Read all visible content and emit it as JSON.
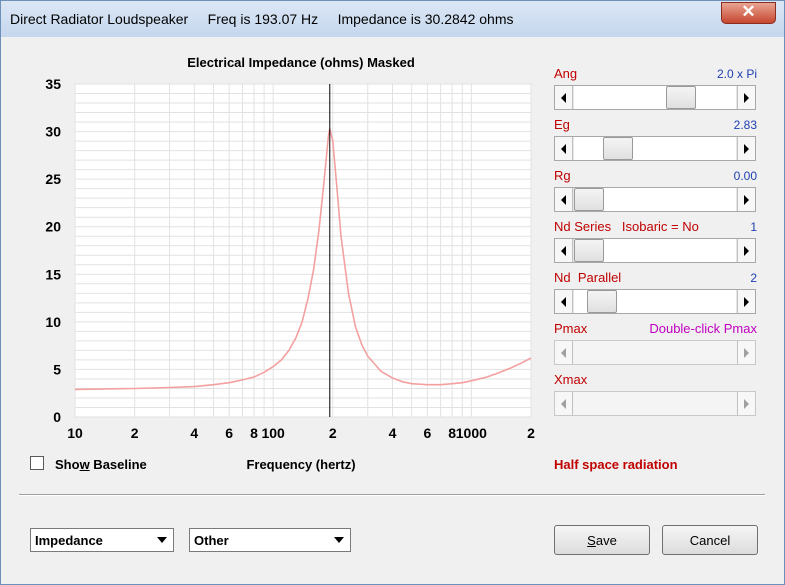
{
  "window": {
    "title": "Direct Radiator Loudspeaker     Freq is 193.07 Hz     Impedance is 30.2842 ohms",
    "close_glyph": "✕"
  },
  "chart_data": {
    "type": "line",
    "title": "Electrical Impedance (ohms)   Masked",
    "xlabel": "Frequency (hertz)",
    "ylabel": "",
    "x_scale": "log",
    "xlim": [
      10,
      2000
    ],
    "ylim": [
      0,
      35
    ],
    "grid": true,
    "x_tick_labels": [
      "10",
      "2",
      "4",
      "6",
      "8",
      "100",
      "2",
      "4",
      "6",
      "8",
      "1000",
      "2"
    ],
    "y_tick_labels": [
      "0",
      "5",
      "10",
      "15",
      "20",
      "25",
      "30",
      "35"
    ],
    "cursor_x": 193.07,
    "series": [
      {
        "color": "#f4a0a0",
        "x": [
          10,
          20,
          30,
          40,
          50,
          60,
          70,
          80,
          90,
          100,
          110,
          120,
          130,
          140,
          150,
          160,
          170,
          180,
          190,
          193,
          200,
          210,
          220,
          240,
          260,
          280,
          300,
          350,
          400,
          450,
          500,
          600,
          700,
          800,
          900,
          1000,
          1200,
          1400,
          1600,
          1800,
          2000
        ],
        "y": [
          2.9,
          3.0,
          3.1,
          3.2,
          3.4,
          3.6,
          3.9,
          4.2,
          4.7,
          5.3,
          6.0,
          7.0,
          8.3,
          10.0,
          12.5,
          15.5,
          19.5,
          24.5,
          29.5,
          30.3,
          29.0,
          24.0,
          19.0,
          13.0,
          9.5,
          7.6,
          6.4,
          4.8,
          4.1,
          3.7,
          3.5,
          3.4,
          3.4,
          3.5,
          3.6,
          3.8,
          4.2,
          4.7,
          5.2,
          5.7,
          6.2
        ]
      }
    ]
  },
  "show_baseline": {
    "label_pre": "Sho",
    "label_ul": "w",
    "label_post": " Baseline",
    "checked": false
  },
  "radiation_note": "Half space radiation",
  "params": [
    {
      "name": "Ang",
      "value": "2.0 x Pi",
      "level": 0.7,
      "enabled": true
    },
    {
      "name": "Eg",
      "value": "2.83",
      "level": 0.22,
      "enabled": true
    },
    {
      "name": "Rg",
      "value": "0.00",
      "level": 0.0,
      "enabled": true
    },
    {
      "name": "Nd Series   Isobaric = No",
      "value": "1",
      "level": 0.0,
      "enabled": true
    },
    {
      "name": "Nd  Parallel",
      "value": "2",
      "level": 0.1,
      "enabled": true
    },
    {
      "name": "Pmax",
      "value": "Double-click Pmax",
      "level": null,
      "enabled": false
    },
    {
      "name": "Xmax",
      "value": "",
      "level": null,
      "enabled": false
    }
  ],
  "bottom": {
    "combo1": "Impedance",
    "combo2": "Other",
    "save_pre": "",
    "save_ul": "S",
    "save_post": "ave",
    "cancel": "Cancel"
  },
  "colors": {
    "title_red": "#c00000",
    "value_blue": "#1f3fb0",
    "pmax_magenta": "#c000c0",
    "curve": "#f4a0a0",
    "grid": "#e2e2e2"
  }
}
